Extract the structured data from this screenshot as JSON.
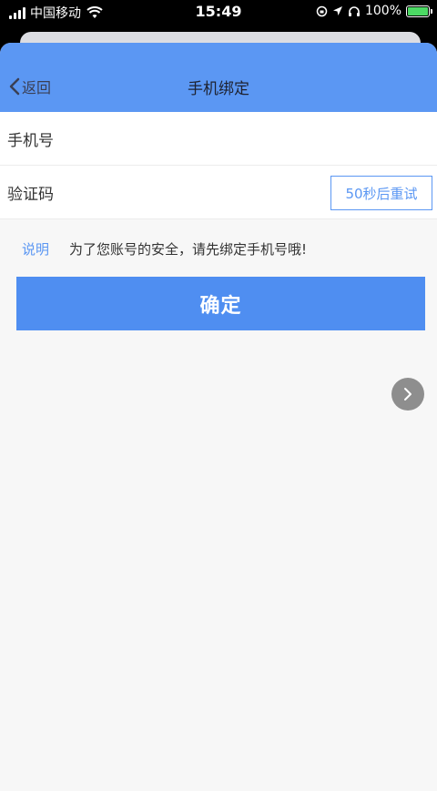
{
  "status_bar": {
    "carrier": "中国移动",
    "time": "15:49",
    "battery_percent": "100%"
  },
  "navbar": {
    "back_label": "返回",
    "title": "手机绑定"
  },
  "form": {
    "phone_label": "手机号",
    "phone_value": "",
    "code_label": "验证码",
    "code_value": "",
    "resend_label": "50秒后重试"
  },
  "note": {
    "label": "说明",
    "text": "为了您账号的安全，请先绑定手机号哦!"
  },
  "confirm_label": "确定",
  "colors": {
    "accent": "#5b97f3",
    "button": "#4f8ef1",
    "background": "#f7f7f7"
  },
  "icons": [
    "signal-icon",
    "wifi-icon",
    "location-icon",
    "headphones-icon",
    "battery-icon",
    "chevron-left-icon",
    "chevron-right-icon"
  ]
}
